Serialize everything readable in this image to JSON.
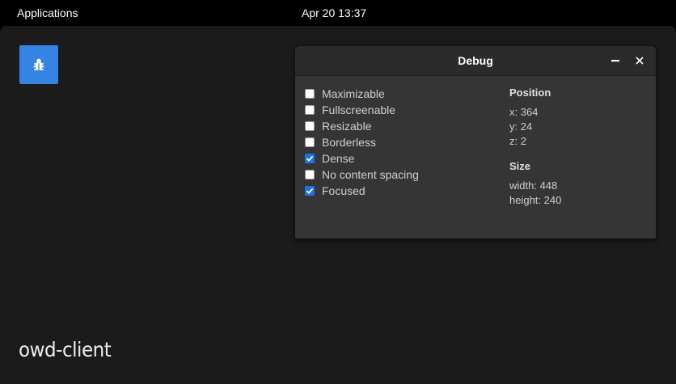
{
  "topbar": {
    "applications_label": "Applications",
    "clock": "Apr 20  13:37"
  },
  "launcher": {
    "icon": "bug-icon",
    "color": "#3584e4"
  },
  "desktop": {
    "client_label": "owd-client"
  },
  "window": {
    "title": "Debug",
    "options": [
      {
        "label": "Maximizable",
        "checked": false
      },
      {
        "label": "Fullscreenable",
        "checked": false
      },
      {
        "label": "Resizable",
        "checked": false
      },
      {
        "label": "Borderless",
        "checked": false
      },
      {
        "label": "Dense",
        "checked": true
      },
      {
        "label": "No content spacing",
        "checked": false
      },
      {
        "label": "Focused",
        "checked": true
      }
    ],
    "position": {
      "heading": "Position",
      "x": "x: 364",
      "y": "y: 24",
      "z": "z: 2"
    },
    "size": {
      "heading": "Size",
      "width": "width: 448",
      "height": "height: 240"
    }
  },
  "colors": {
    "accent": "#3584e4",
    "checkbox_checked": "#1a73e8",
    "desktop_bg": "#1b1b1b",
    "window_bg": "#353535"
  }
}
